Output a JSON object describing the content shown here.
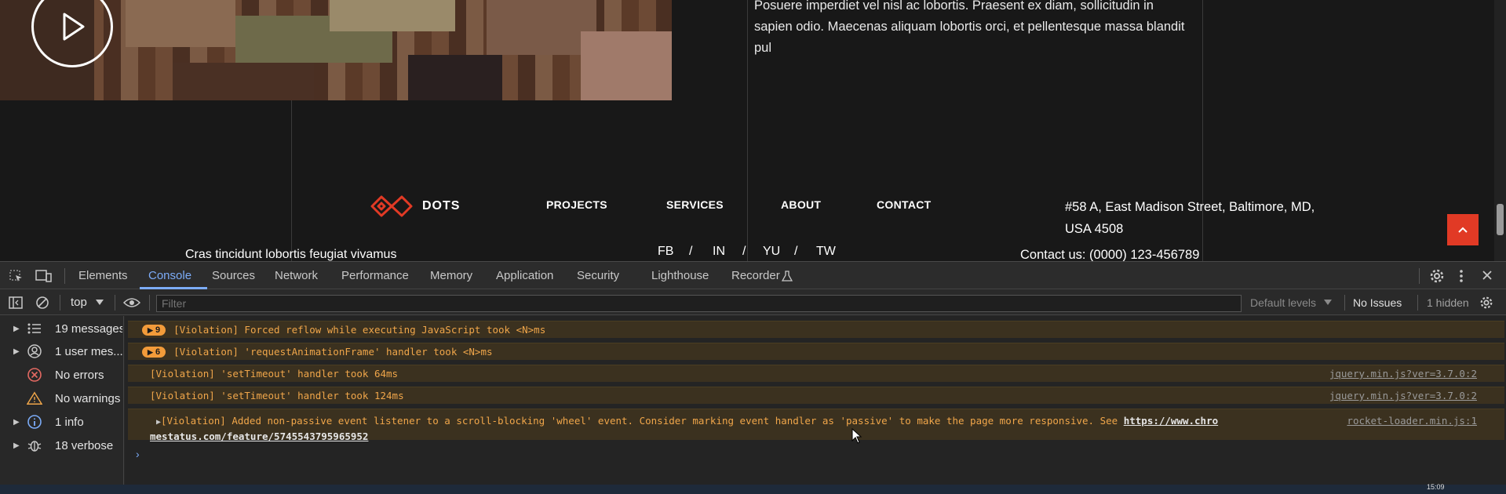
{
  "site": {
    "body_text": "Posuere imperdiet vel nisl ac lobortis. Praesent ex diam, sollicitudin in sapien odio. Maecenas aliquam lobortis orci, et pellentesque massa blandit pul",
    "logo_text": "DOTS",
    "nav": [
      "PROJECTS",
      "SERVICES",
      "ABOUT",
      "CONTACT"
    ],
    "address": "#58 A, East Madison Street, Baltimore, MD, USA 4508",
    "tagline": "Cras tincidunt lobortis feugiat vivamus",
    "social": [
      "FB",
      "IN",
      "YU",
      "TW"
    ],
    "social_sep": "/",
    "contact": "Contact us: (0000) 123-456789"
  },
  "devtools": {
    "tabs": [
      "Elements",
      "Console",
      "Sources",
      "Network",
      "Performance",
      "Memory",
      "Application",
      "Security",
      "Lighthouse",
      "Recorder"
    ],
    "active_tab": "Console",
    "context": "top",
    "filter_placeholder": "Filter",
    "levels": "Default levels",
    "issues": "No Issues",
    "hidden": "1 hidden",
    "sidebar": [
      {
        "label": "19 messages",
        "icon": "list-icon"
      },
      {
        "label": "1 user mes...",
        "icon": "user-icon"
      },
      {
        "label": "No errors",
        "icon": "error-icon"
      },
      {
        "label": "No warnings",
        "icon": "warning-icon"
      },
      {
        "label": "1 info",
        "icon": "info-icon"
      },
      {
        "label": "18 verbose",
        "icon": "bug-icon"
      }
    ],
    "messages": [
      {
        "count": "9",
        "text": "[Violation] Forced reflow while executing JavaScript took <N>ms",
        "source": ""
      },
      {
        "count": "6",
        "text": "[Violation] 'requestAnimationFrame' handler took <N>ms",
        "source": ""
      },
      {
        "count": "",
        "text": "[Violation] 'setTimeout' handler took 64ms",
        "source": "jquery.min.js?ver=3.7.0:2"
      },
      {
        "count": "",
        "text": "[Violation] 'setTimeout' handler took 124ms",
        "source": "jquery.min.js?ver=3.7.0:2"
      }
    ],
    "long_message": {
      "text": "[Violation] Added non-passive event listener to a scroll-blocking 'wheel' event. Consider marking event handler as 'passive' to make the page more responsive. See ",
      "link_part1": "https://www.chro",
      "link_part2": "mestatus.com/feature/5745543795965952",
      "source": "rocket-loader.min.js:1"
    },
    "colors": {
      "accent": "#7cacf8",
      "warning": "#f0a64a",
      "brand": "#e13a25"
    }
  },
  "taskbar": {
    "clock": "15:09"
  }
}
